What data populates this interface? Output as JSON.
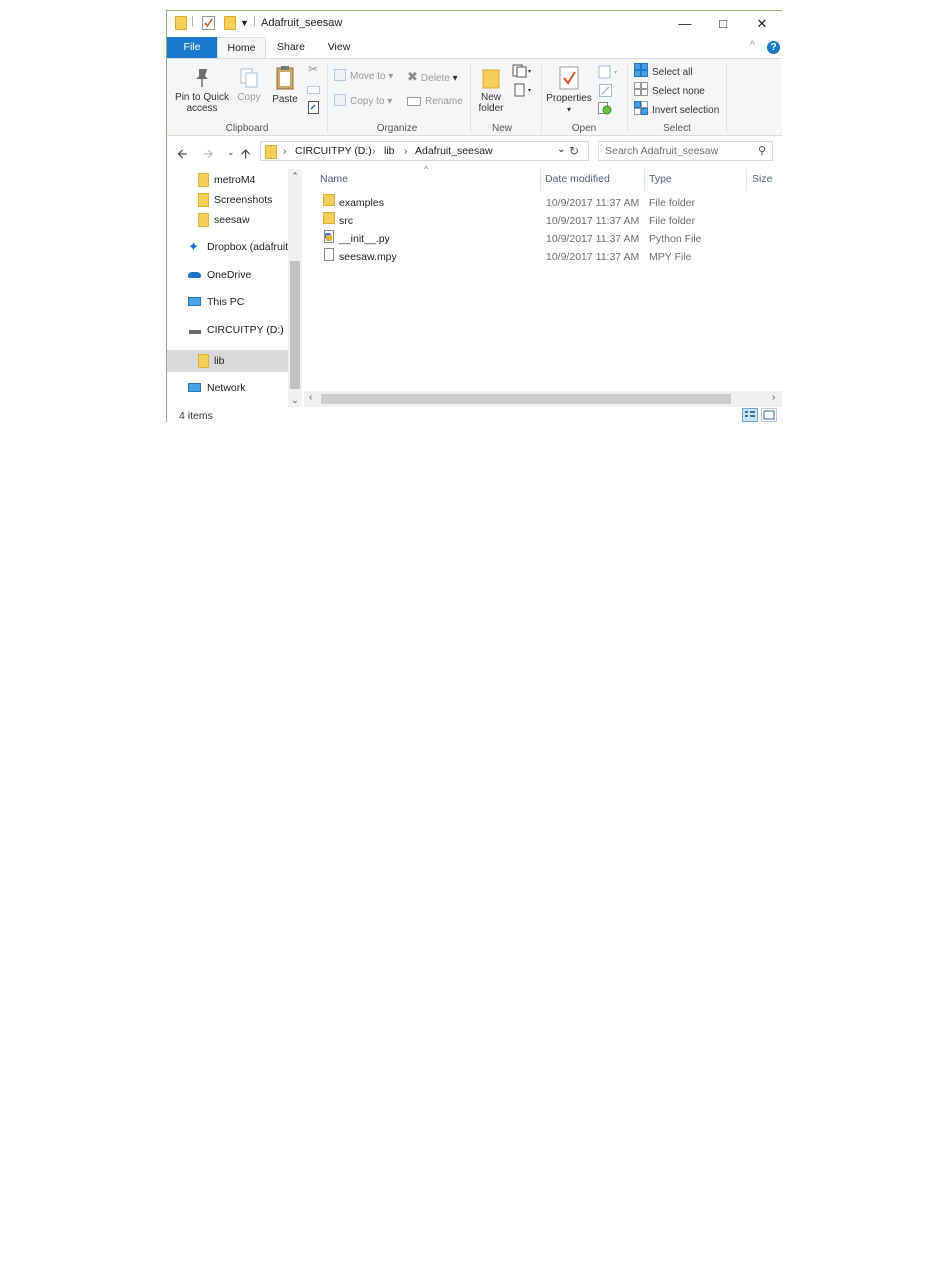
{
  "window": {
    "title": "Adafruit_seesaw"
  },
  "controls": {
    "minimize": "—",
    "maximize": "□",
    "close": "✕",
    "collapse": "^",
    "help": "?"
  },
  "tabs": {
    "file": "File",
    "home": "Home",
    "share": "Share",
    "view": "View"
  },
  "ribbon": {
    "clipboard": {
      "label": "Clipboard",
      "pin": "Pin to Quick access",
      "copy": "Copy",
      "paste": "Paste"
    },
    "organize": {
      "label": "Organize",
      "move_to": "Move to",
      "copy_to": "Copy to",
      "delete": "Delete",
      "rename": "Rename"
    },
    "new": {
      "label": "New",
      "new_folder": "New folder"
    },
    "open": {
      "label": "Open",
      "properties": "Properties"
    },
    "select": {
      "label": "Select",
      "select_all": "Select all",
      "select_none": "Select none",
      "invert": "Invert selection"
    }
  },
  "address": {
    "crumbs": [
      "CIRCUITPY (D:)",
      "lib",
      "Adafruit_seesaw"
    ]
  },
  "search": {
    "placeholder": "Search Adafruit_seesaw"
  },
  "nav": {
    "items": [
      {
        "label": "metroM4"
      },
      {
        "label": "Screenshots"
      },
      {
        "label": "seesaw"
      },
      {
        "label": "Dropbox (adafruit"
      },
      {
        "label": "OneDrive"
      },
      {
        "label": "This PC"
      },
      {
        "label": "CIRCUITPY (D:)"
      },
      {
        "label": "lib"
      },
      {
        "label": "Network"
      }
    ]
  },
  "columns": {
    "name": "Name",
    "date": "Date modified",
    "type": "Type",
    "size": "Size"
  },
  "files": [
    {
      "name": "examples",
      "date": "10/9/2017 11:37 AM",
      "type": "File folder"
    },
    {
      "name": "src",
      "date": "10/9/2017 11:37 AM",
      "type": "File folder"
    },
    {
      "name": "__init__.py",
      "date": "10/9/2017 11:37 AM",
      "type": "Python File"
    },
    {
      "name": "seesaw.mpy",
      "date": "10/9/2017 11:37 AM",
      "type": "MPY File"
    }
  ],
  "status": {
    "count": "4 items"
  }
}
